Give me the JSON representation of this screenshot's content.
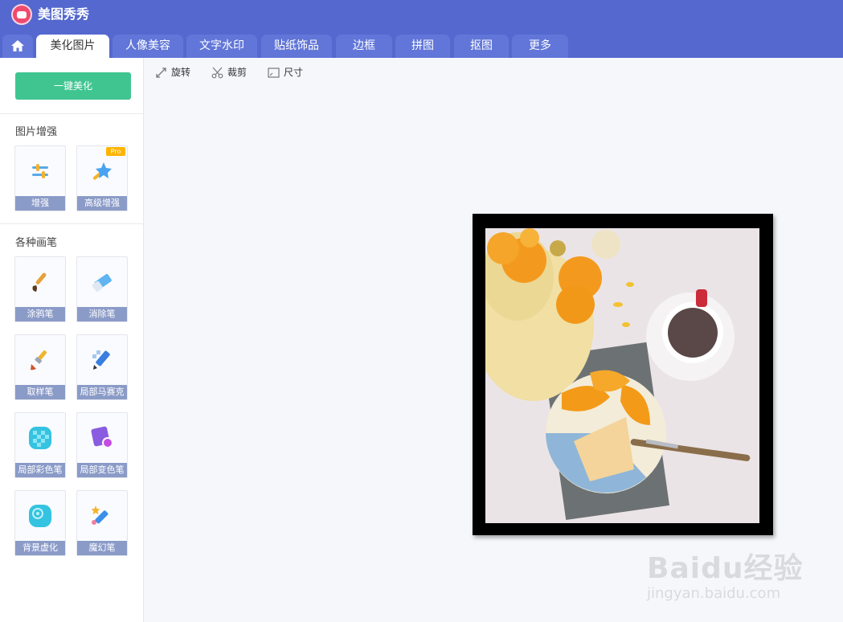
{
  "app": {
    "title": "美图秀秀"
  },
  "tabs": [
    {
      "label": "美化图片",
      "active": true
    },
    {
      "label": "人像美容"
    },
    {
      "label": "文字水印"
    },
    {
      "label": "贴纸饰品"
    },
    {
      "label": "边框"
    },
    {
      "label": "拼图"
    },
    {
      "label": "抠图"
    },
    {
      "label": "更多"
    }
  ],
  "sidebar": {
    "one_key_label": "一键美化",
    "enhance_section": "图片增强",
    "brush_section": "各种画笔",
    "enhance_tools": [
      {
        "label": "增强",
        "icon": "sliders-icon"
      },
      {
        "label": "高级增强",
        "icon": "magic-star-icon",
        "badge": "Pro"
      }
    ],
    "brush_tools": [
      {
        "label": "涂鸦笔",
        "icon": "paintbrush-icon"
      },
      {
        "label": "消除笔",
        "icon": "eraser-icon"
      },
      {
        "label": "取样笔",
        "icon": "sample-brush-icon"
      },
      {
        "label": "局部马赛克",
        "icon": "mosaic-pen-icon"
      },
      {
        "label": "局部彩色笔",
        "icon": "color-pen-icon"
      },
      {
        "label": "局部变色笔",
        "icon": "recolor-pen-icon"
      },
      {
        "label": "背景虚化",
        "icon": "blur-icon"
      },
      {
        "label": "魔幻笔",
        "icon": "magic-pen-icon"
      }
    ]
  },
  "toolbar": {
    "rotate_label": "旋转",
    "crop_label": "裁剪",
    "size_label": "尺寸"
  },
  "watermark": {
    "text": "Baidu经验",
    "url": "jingyan.baidu.com"
  },
  "colors": {
    "header": "#5468cf",
    "tab_inactive": "#6176d8",
    "accent_green": "#40c591",
    "tool_label_bg": "#8b9bc8",
    "pro_badge": "#ffb400"
  }
}
